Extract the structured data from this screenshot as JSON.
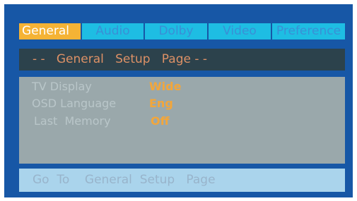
{
  "tabs": [
    {
      "label": "General",
      "active": true
    },
    {
      "label": "Audio",
      "active": false
    },
    {
      "label": "Dolby",
      "active": false
    },
    {
      "label": "Video",
      "active": false
    },
    {
      "label": "Preference",
      "active": false
    }
  ],
  "header": {
    "title": "- -   General   Setup   Page - -"
  },
  "settings": [
    {
      "label": "TV Display",
      "value": "Wide"
    },
    {
      "label": "OSD Language",
      "value": "Eng"
    },
    {
      "label": "Last  Memory",
      "value": "Off"
    }
  ],
  "footer": {
    "hint": "Go  To    General  Setup   Page"
  },
  "colors": {
    "background": "#1757a6",
    "tab_active": "#f5b335",
    "tab_inactive": "#1ebde3",
    "header_bar": "#2c424c",
    "panel": "#9aa8ab",
    "footer_bar": "#aad4ec",
    "value_text": "#f3a63a"
  }
}
